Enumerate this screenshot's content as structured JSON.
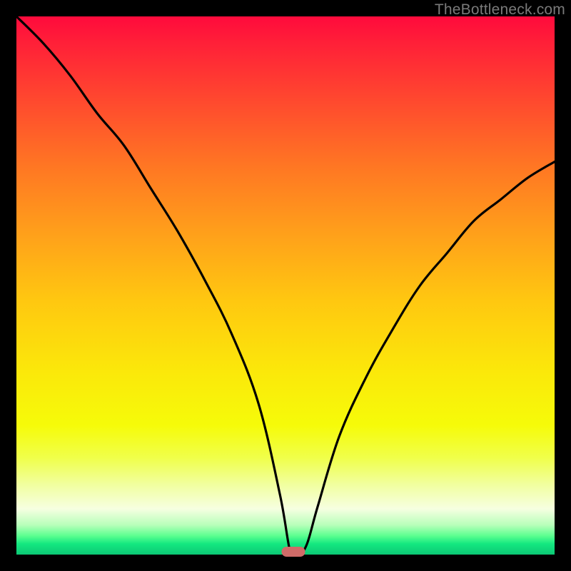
{
  "watermark": "TheBottleneck.com",
  "colors": {
    "frame": "#000000",
    "marker": "#cf6b68",
    "curve": "#000000"
  },
  "chart_data": {
    "type": "line",
    "title": "",
    "xlabel": "",
    "ylabel": "",
    "xlim": [
      0,
      1
    ],
    "ylim": [
      0,
      1
    ],
    "x": [
      0.0,
      0.05,
      0.1,
      0.15,
      0.2,
      0.25,
      0.3,
      0.35,
      0.4,
      0.45,
      0.49,
      0.51,
      0.525,
      0.54,
      0.56,
      0.6,
      0.65,
      0.7,
      0.75,
      0.8,
      0.85,
      0.9,
      0.95,
      1.0
    ],
    "values": [
      1.0,
      0.95,
      0.89,
      0.82,
      0.76,
      0.68,
      0.6,
      0.51,
      0.41,
      0.28,
      0.11,
      0.0,
      0.0,
      0.02,
      0.09,
      0.22,
      0.33,
      0.42,
      0.5,
      0.56,
      0.62,
      0.66,
      0.7,
      0.73
    ],
    "marker": {
      "x": 0.515,
      "y": 0.0
    },
    "annotations": [],
    "legend": []
  }
}
